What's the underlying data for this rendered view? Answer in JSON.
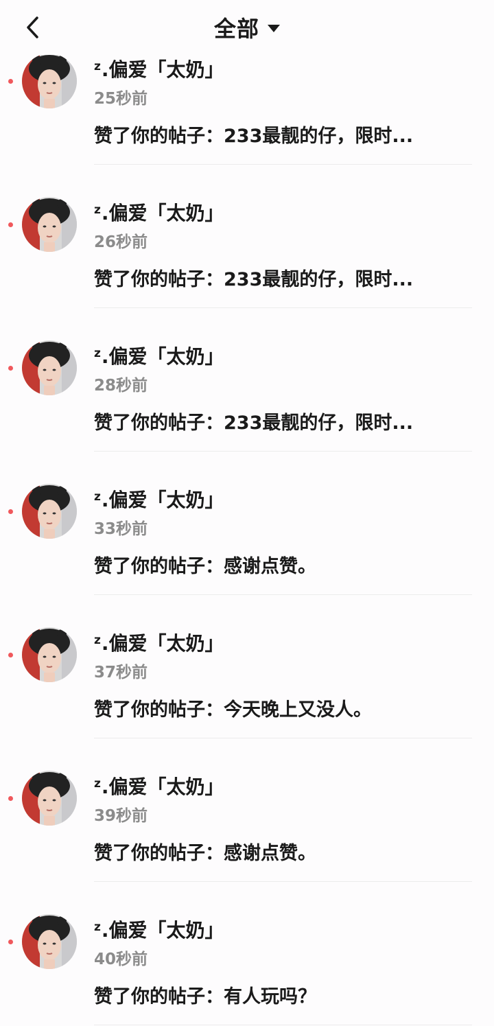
{
  "header": {
    "title": "全部",
    "back_icon": "chevron-left-icon",
    "dropdown_icon": "caret-down-icon"
  },
  "colors": {
    "unread_dot": "#f0585c",
    "time_text": "#8b8b8b",
    "divider": "#ececec"
  },
  "notifications": [
    {
      "name_prefix": "z",
      "name": ".偏爱「太奶」",
      "time": "25秒前",
      "message": "赞了你的帖子：233最靓的仔，限时..."
    },
    {
      "name_prefix": "z",
      "name": ".偏爱「太奶」",
      "time": "26秒前",
      "message": "赞了你的帖子：233最靓的仔，限时..."
    },
    {
      "name_prefix": "z",
      "name": ".偏爱「太奶」",
      "time": "28秒前",
      "message": "赞了你的帖子：233最靓的仔，限时..."
    },
    {
      "name_prefix": "z",
      "name": ".偏爱「太奶」",
      "time": "33秒前",
      "message": "赞了你的帖子：感谢点赞。"
    },
    {
      "name_prefix": "z",
      "name": ".偏爱「太奶」",
      "time": "37秒前",
      "message": "赞了你的帖子：今天晚上又没人。"
    },
    {
      "name_prefix": "z",
      "name": ".偏爱「太奶」",
      "time": "39秒前",
      "message": "赞了你的帖子：感谢点赞。"
    },
    {
      "name_prefix": "z",
      "name": ".偏爱「太奶」",
      "time": "40秒前",
      "message": "赞了你的帖子：有人玩吗？"
    }
  ]
}
